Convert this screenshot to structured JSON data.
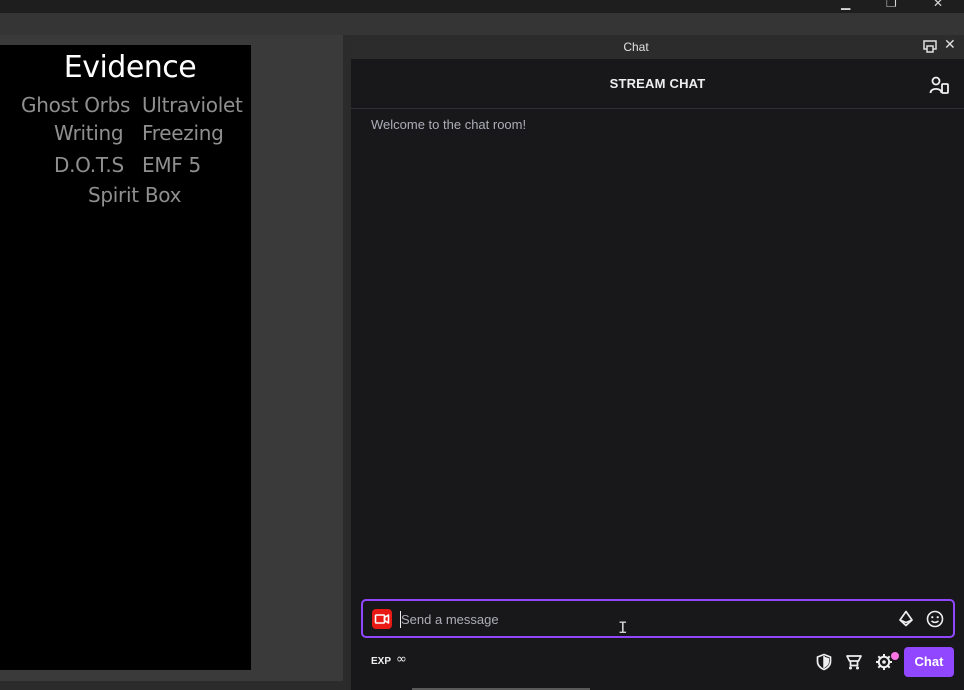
{
  "window": {
    "minimize_glyph": "▁",
    "restore_glyph": "❐",
    "close_glyph": "✕"
  },
  "evidence": {
    "title": "Evidence",
    "items": [
      "Ghost Orbs",
      "Ultraviolet",
      "Writing",
      "Freezing",
      "D.O.T.S",
      "EMF 5",
      "Spirit Box"
    ]
  },
  "dock": {
    "title": "Chat",
    "close_glyph": "✕"
  },
  "chat": {
    "header": "STREAM CHAT",
    "welcome": "Welcome to the chat room!",
    "input_placeholder": "Send a message",
    "exp_label": "EXP",
    "exp_value": "∞",
    "send_label": "Chat"
  },
  "colors": {
    "accent": "#9147ff",
    "camera": "#e91916",
    "notification": "#ff75e6"
  },
  "icons": [
    "camera-icon",
    "bits-icon",
    "emote-icon",
    "users-icon",
    "moderation-shield-icon",
    "hype-train-icon",
    "settings-icon",
    "popout-icon"
  ]
}
